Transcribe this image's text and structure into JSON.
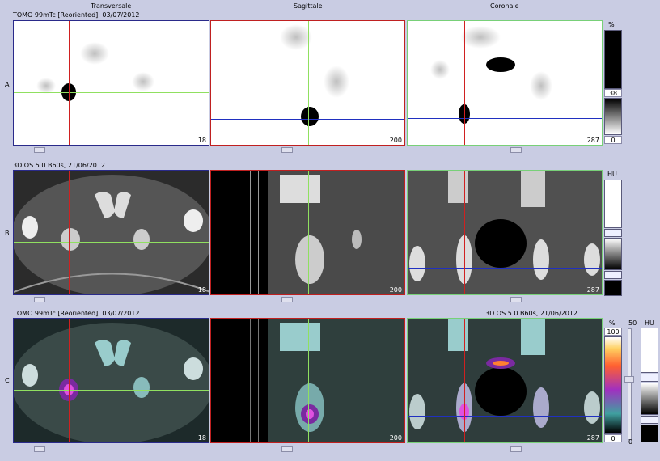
{
  "header": {
    "row_a_caption": "TOMO 99mTc [Reoriented], 03/07/2012",
    "view_transversal": "Transversale",
    "view_sagittal": "Sagittale",
    "view_coronal": "Coronale"
  },
  "rows": {
    "a": {
      "label": "A",
      "caption": "TOMO 99mTc [Reoriented], 03/07/2012"
    },
    "b": {
      "label": "B",
      "caption": "3D OS 5.0 B60s, 21/06/2012"
    },
    "c": {
      "label": "C",
      "caption_left": "TOMO 99mTc [Reoriented], 03/07/2012",
      "caption_right": "3D OS 5.0 B60s, 21/06/2012"
    }
  },
  "slices": {
    "transversal": "18",
    "sagittal": "200",
    "coronal": "287"
  },
  "scales": {
    "a": {
      "unit": "%",
      "max": "38",
      "min": "0"
    },
    "b": {
      "unit": "HU"
    },
    "c": {
      "unit": "%",
      "max": "100",
      "min": "0",
      "fusion_value": "50",
      "hu_unit": "HU",
      "fusion_min": "0"
    }
  },
  "colors": {
    "crosshair_red": "#d02020",
    "crosshair_green": "#90e060",
    "crosshair_blue": "#2030c0",
    "background": "#c9cce3"
  }
}
